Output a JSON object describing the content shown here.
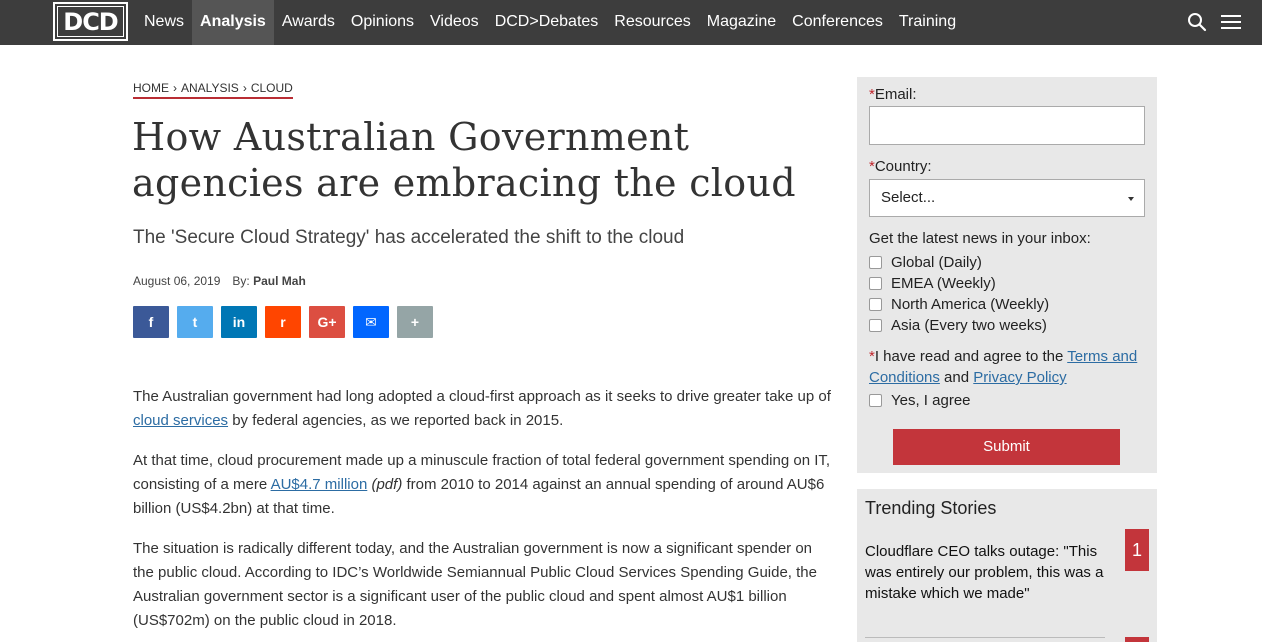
{
  "nav": {
    "logo_text": "DCD",
    "links": [
      "News",
      "Analysis",
      "Awards",
      "Opinions",
      "Videos",
      "DCD>Debates",
      "Resources",
      "Magazine",
      "Conferences",
      "Training"
    ],
    "active": "Analysis"
  },
  "article": {
    "breadcrumb": [
      "HOME",
      "ANALYSIS",
      "CLOUD"
    ],
    "breadcrumb_sep": "›",
    "title_line1": "How Australian Government",
    "title_line2": "agencies are embracing the cloud",
    "subtitle": "The 'Secure Cloud Strategy' has accelerated the shift to the cloud",
    "date": "August 06, 2019",
    "by_label": "By:",
    "author": "Paul Mah",
    "share_buttons": [
      {
        "name": "facebook",
        "glyph": "f",
        "color": "#3b5998"
      },
      {
        "name": "twitter",
        "glyph": "t",
        "color": "#55acee"
      },
      {
        "name": "linkedin",
        "glyph": "in",
        "color": "#0077b5"
      },
      {
        "name": "reddit",
        "glyph": "r",
        "color": "#ff4500"
      },
      {
        "name": "google-plus",
        "glyph": "G+",
        "color": "#dc4e41"
      },
      {
        "name": "email",
        "glyph": "✉",
        "color": "#0166ff"
      },
      {
        "name": "more",
        "glyph": "+",
        "color": "#95a5a6"
      }
    ],
    "p1_a": "The Australian government had long adopted a cloud-first approach as it seeks to drive greater take up of ",
    "p1_link": "cloud services",
    "p1_b": " by federal agencies, as we reported back in 2015.",
    "p2_a": "At that time, cloud procurement made up a minuscule fraction of total federal government spending on IT, consisting of a mere ",
    "p2_link": "AU$4.7 million",
    "p2_em": "(pdf)",
    "p2_b": " from 2010 to 2014 against an annual spending of around AU$6 billion (US$4.2bn) at that time.",
    "p3": "The situation is radically different today, and the Australian government is now a significant spender on the public cloud. According to IDC’s Worldwide Semiannual Public Cloud Services Spending Guide, the Australian government sector is a significant user of the public cloud and spent almost AU$1 billion (US$702m) on the public cloud in 2018."
  },
  "form": {
    "required_mark": "*",
    "email_label": "Email:",
    "email_value": "",
    "country_label": "Country:",
    "country_selected": "Select...",
    "newsletter_label": "Get the latest news in your inbox:",
    "options": [
      "Global (Daily)",
      "EMEA (Weekly)",
      "North America (Weekly)",
      "Asia (Every two weeks)"
    ],
    "agree_a": "I have read and agree to the ",
    "terms_link": "Terms and Conditions",
    "agree_and": " and ",
    "privacy_link": "Privacy Policy",
    "yes_label": "Yes, I agree",
    "submit_label": "Submit"
  },
  "trending": {
    "heading": "Trending Stories",
    "items": [
      {
        "rank": "1",
        "title": "Cloudflare CEO talks outage: \"This was entirely our problem, this was a mistake which we made\""
      }
    ]
  }
}
